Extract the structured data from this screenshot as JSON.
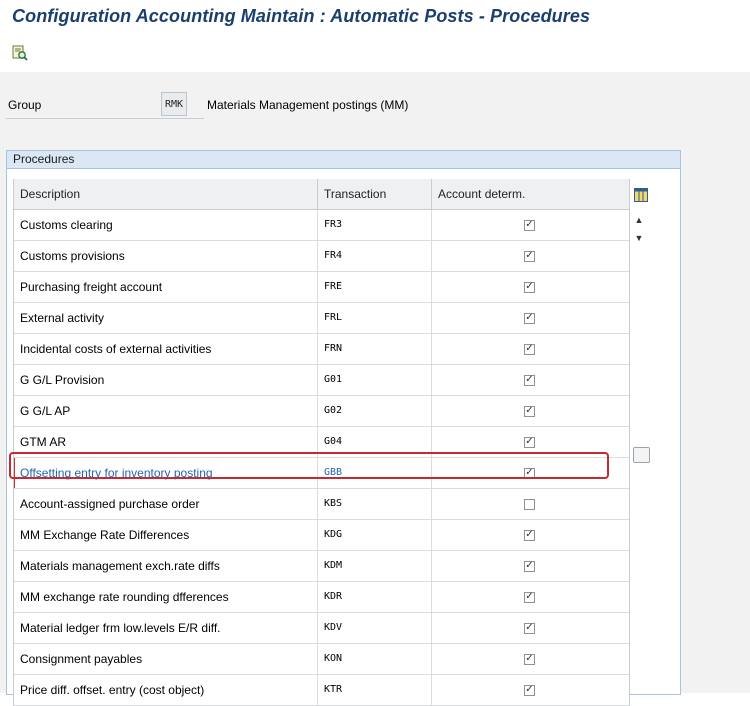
{
  "title": "Configuration Accounting Maintain : Automatic Posts - Procedures",
  "toolbar": {
    "icon": "find-icon"
  },
  "group": {
    "label": "Group",
    "value": "RMK",
    "description": "Materials Management postings (MM)"
  },
  "panel": {
    "title": "Procedures"
  },
  "table": {
    "columns": [
      "Description",
      "Transaction",
      "Account determ."
    ],
    "rows": [
      {
        "description": "Customs clearing",
        "transaction": "FR3",
        "checked": true
      },
      {
        "description": "Customs provisions",
        "transaction": "FR4",
        "checked": true
      },
      {
        "description": "Purchasing freight account",
        "transaction": "FRE",
        "checked": true
      },
      {
        "description": "External activity",
        "transaction": "FRL",
        "checked": true
      },
      {
        "description": "Incidental costs of external activities",
        "transaction": "FRN",
        "checked": true
      },
      {
        "description": "G G/L Provision",
        "transaction": "G01",
        "checked": true
      },
      {
        "description": "G G/L AP",
        "transaction": "G02",
        "checked": true
      },
      {
        "description": "GTM AR",
        "transaction": "G04",
        "checked": true
      },
      {
        "description": "Offsetting entry for inventory posting",
        "transaction": "GBB",
        "checked": true,
        "selected": true
      },
      {
        "description": "Account-assigned purchase order",
        "transaction": "KBS",
        "checked": false
      },
      {
        "description": "MM Exchange Rate Differences",
        "transaction": "KDG",
        "checked": true
      },
      {
        "description": "Materials management exch.rate diffs",
        "transaction": "KDM",
        "checked": true
      },
      {
        "description": "MM exchange rate rounding dfferences",
        "transaction": "KDR",
        "checked": true
      },
      {
        "description": "Material ledger frm low.levels E/R diff.",
        "transaction": "KDV",
        "checked": true
      },
      {
        "description": "Consignment payables",
        "transaction": "KON",
        "checked": true
      },
      {
        "description": "Price diff. offset. entry (cost object)",
        "transaction": "KTR",
        "checked": true
      }
    ]
  },
  "colors": {
    "title": "#1a3f6e",
    "selected_text": "#1f66b3",
    "highlight": "#c8282f",
    "panel_header": "#dbe7f4"
  }
}
